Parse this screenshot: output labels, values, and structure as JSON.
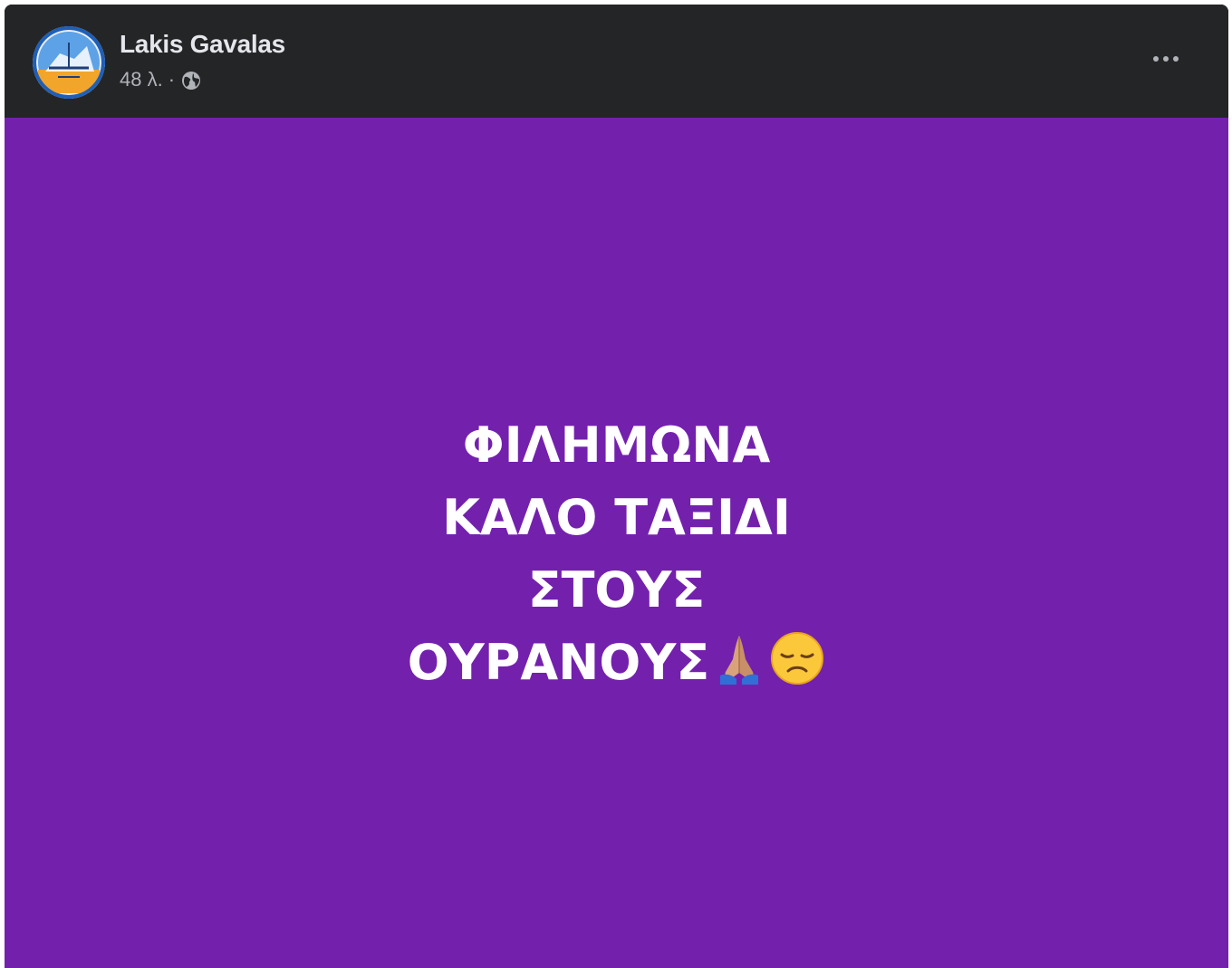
{
  "post": {
    "author_name": "Lakis Gavalas",
    "timestamp": "48 λ.",
    "separator": "·",
    "privacy_icon": "globe-icon",
    "more_icon": "more-options-icon",
    "background_color": "#7321ad",
    "text_lines": [
      "ΦΙΛΗΜΩΝΑ",
      "ΚΑΛΟ ΤΑΞΙΔΙ",
      "ΣΤΟΥΣ",
      "ΟΥΡΑΝΟΥΣ"
    ],
    "emojis": [
      "folded-hands-emoji",
      "disappointed-face-emoji"
    ]
  }
}
